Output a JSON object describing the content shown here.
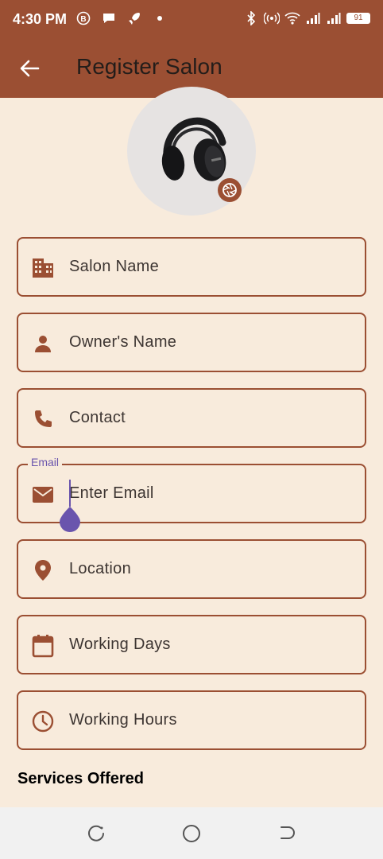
{
  "status_bar": {
    "time": "4:30 PM",
    "battery": "91",
    "left_icons": [
      "b-circle-icon",
      "chat-icon",
      "rocket-icon",
      "dot-icon"
    ],
    "right_icons": [
      "bluetooth-icon",
      "hotspot-icon",
      "wifi-icon",
      "signal-icon",
      "signal-icon",
      "battery-icon"
    ]
  },
  "app_bar": {
    "title": "Register Salon",
    "background": "#9b4f33"
  },
  "form": {
    "fields": [
      {
        "icon": "building-icon",
        "placeholder": "Salon Name"
      },
      {
        "icon": "person-icon",
        "placeholder": "Owner's Name"
      },
      {
        "icon": "phone-icon",
        "placeholder": "Contact"
      },
      {
        "icon": "mail-icon",
        "label": "Email",
        "placeholder": "Enter Email"
      },
      {
        "icon": "location-pin-icon",
        "placeholder": "Location"
      },
      {
        "icon": "calendar-icon",
        "placeholder": "Working Days"
      },
      {
        "icon": "clock-icon",
        "placeholder": "Working Hours"
      }
    ]
  },
  "services": {
    "heading": "Services Offered"
  },
  "colors": {
    "accent": "#9b4f33",
    "background": "#f8ebdc",
    "focus": "#6a55ad"
  }
}
